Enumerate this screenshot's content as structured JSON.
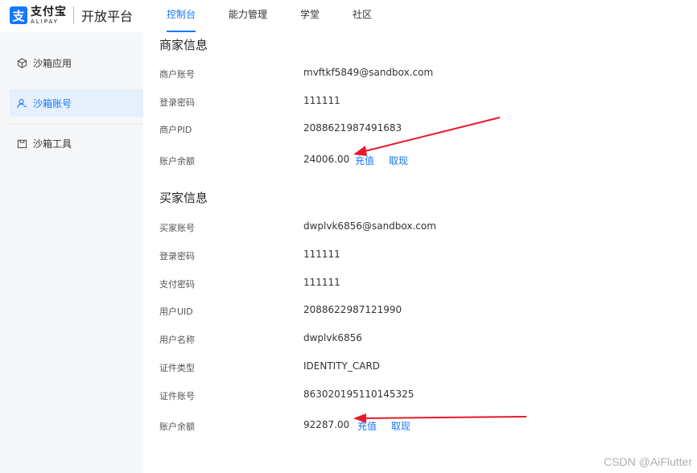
{
  "header": {
    "logo_cn": "支付宝",
    "logo_en": "ALIPAY",
    "platform": "开放平台",
    "nav": [
      {
        "label": "控制台",
        "active": true
      },
      {
        "label": "能力管理",
        "active": false
      },
      {
        "label": "学堂",
        "active": false
      },
      {
        "label": "社区",
        "active": false
      }
    ]
  },
  "sidebar": {
    "items": [
      {
        "label": "沙箱应用",
        "icon": "cube-icon",
        "active": false
      },
      {
        "label": "沙箱账号",
        "icon": "user-icon",
        "active": true
      },
      {
        "label": "沙箱工具",
        "icon": "toolbox-icon",
        "active": false
      }
    ]
  },
  "merchant": {
    "title": "商家信息",
    "rows": [
      {
        "label": "商户账号",
        "value": "mvftkf5849@sandbox.com"
      },
      {
        "label": "登录密码",
        "value": "111111"
      },
      {
        "label": "商户PID",
        "value": "2088621987491683"
      },
      {
        "label": "账户余额",
        "value": "24006.00"
      }
    ],
    "recharge_label": "充值",
    "withdraw_label": "取现"
  },
  "buyer": {
    "title": "买家信息",
    "rows": [
      {
        "label": "买家账号",
        "value": "dwplvk6856@sandbox.com"
      },
      {
        "label": "登录密码",
        "value": "111111"
      },
      {
        "label": "支付密码",
        "value": "111111"
      },
      {
        "label": "用户UID",
        "value": "2088622987121990"
      },
      {
        "label": "用户名称",
        "value": "dwplvk6856"
      },
      {
        "label": "证件类型",
        "value": "IDENTITY_CARD"
      },
      {
        "label": "证件账号",
        "value": "863020195110145325"
      },
      {
        "label": "账户余额",
        "value": "92287.00"
      }
    ],
    "recharge_label": "充值",
    "withdraw_label": "取现"
  },
  "annotations": {
    "arrow_color": "#e8192c"
  },
  "watermark": "CSDN @AiFlutter",
  "colors": {
    "accent": "#1677ff",
    "sidebar_bg": "#f6f7f9",
    "sidebar_active_bg": "#e6f0fc"
  }
}
